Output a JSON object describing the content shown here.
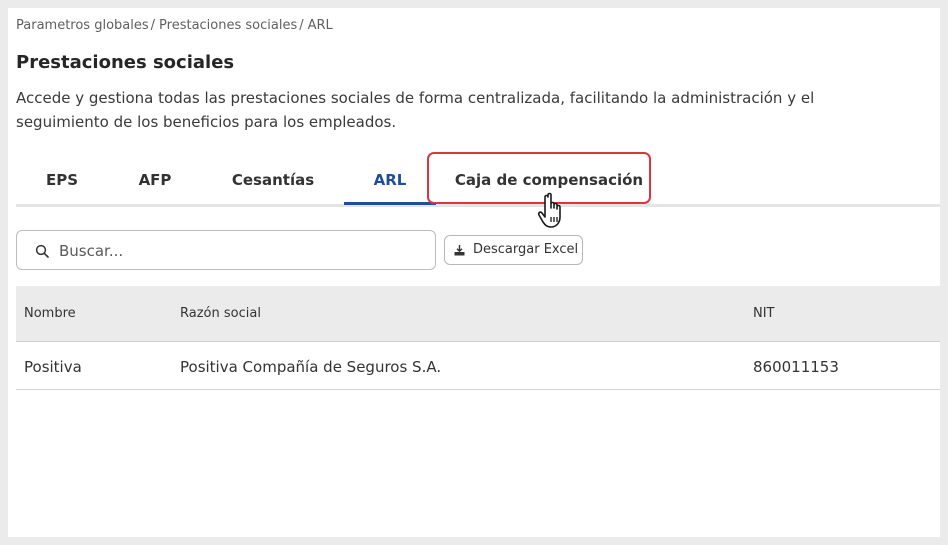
{
  "breadcrumb": {
    "item1": "Parametros globales",
    "item2": "Prestaciones sociales",
    "item3": "ARL",
    "separator": "/"
  },
  "page": {
    "title": "Prestaciones sociales",
    "description": "Accede y gestiona todas las prestaciones sociales de forma centralizada, facilitando la administración y el seguimiento de los beneficios para los empleados."
  },
  "tabs": [
    {
      "label": "EPS",
      "active": false
    },
    {
      "label": "AFP",
      "active": false
    },
    {
      "label": "Cesantías",
      "active": false
    },
    {
      "label": "ARL",
      "active": true
    },
    {
      "label": "Caja de compensación",
      "active": false,
      "highlighted": true
    }
  ],
  "search": {
    "placeholder": "Buscar...",
    "value": "",
    "icon": "search-icon"
  },
  "toolbar": {
    "excel_label": "Descargar Excel",
    "excel_icon": "download-icon"
  },
  "table": {
    "columns": [
      "Nombre",
      "Razón social",
      "NIT"
    ],
    "rows": [
      [
        "Positiva",
        "Positiva Compañía de Seguros S.A.",
        "860011153"
      ]
    ]
  },
  "colors": {
    "accent": "#1f4e9c",
    "highlight": "#d9363e"
  }
}
